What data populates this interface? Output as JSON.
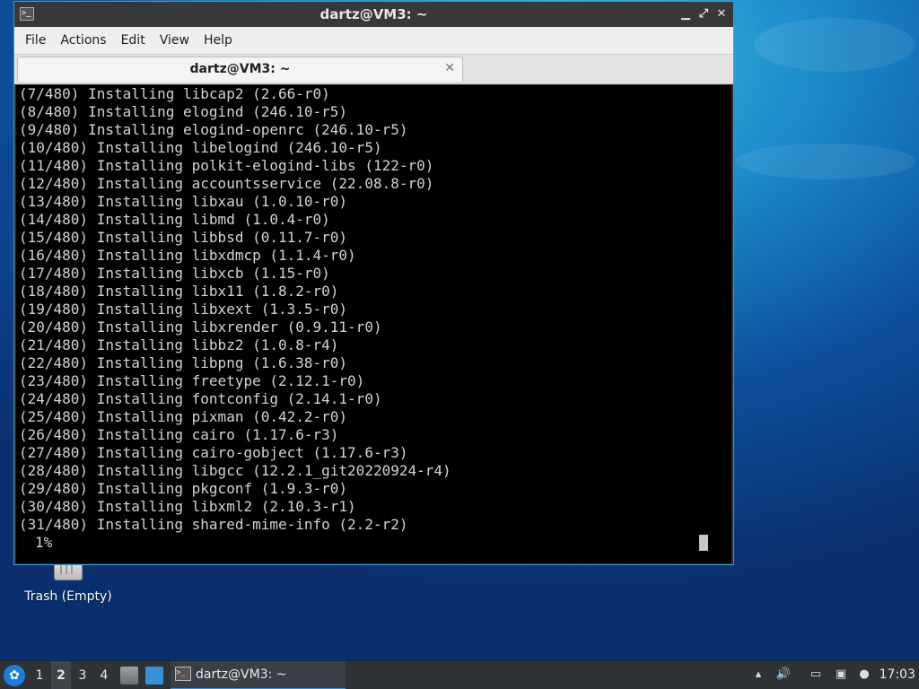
{
  "desktop": {
    "trash_label": "Trash (Empty)"
  },
  "window": {
    "title": "dartz@VM3: ~",
    "controls": [
      "minimize",
      "maximize",
      "close"
    ],
    "menu": [
      "File",
      "Actions",
      "Edit",
      "View",
      "Help"
    ],
    "tab_label": "dartz@VM3: ~",
    "terminal_lines": [
      "(7/480) Installing libcap2 (2.66-r0)",
      "(8/480) Installing elogind (246.10-r5)",
      "(9/480) Installing elogind-openrc (246.10-r5)",
      "(10/480) Installing libelogind (246.10-r5)",
      "(11/480) Installing polkit-elogind-libs (122-r0)",
      "(12/480) Installing accountsservice (22.08.8-r0)",
      "(13/480) Installing libxau (1.0.10-r0)",
      "(14/480) Installing libmd (1.0.4-r0)",
      "(15/480) Installing libbsd (0.11.7-r0)",
      "(16/480) Installing libxdmcp (1.1.4-r0)",
      "(17/480) Installing libxcb (1.15-r0)",
      "(18/480) Installing libx11 (1.8.2-r0)",
      "(19/480) Installing libxext (1.3.5-r0)",
      "(20/480) Installing libxrender (0.9.11-r0)",
      "(21/480) Installing libbz2 (1.0.8-r4)",
      "(22/480) Installing libpng (1.6.38-r0)",
      "(23/480) Installing freetype (2.12.1-r0)",
      "(24/480) Installing fontconfig (2.14.1-r0)",
      "(25/480) Installing pixman (0.42.2-r0)",
      "(26/480) Installing cairo (1.17.6-r3)",
      "(27/480) Installing cairo-gobject (1.17.6-r3)",
      "(28/480) Installing libgcc (12.2.1_git20220924-r4)",
      "(29/480) Installing pkgconf (1.9.3-r0)",
      "(30/480) Installing libxml2 (2.10.3-r1)",
      "(31/480) Installing shared-mime-info (2.2-r2)"
    ],
    "progress": "1%"
  },
  "taskbar": {
    "workspaces": [
      "1",
      "2",
      "3",
      "4"
    ],
    "active_workspace": "2",
    "task_label": "dartz@VM3: ~",
    "clock": "17:03",
    "accent": "#3a8fd6"
  }
}
